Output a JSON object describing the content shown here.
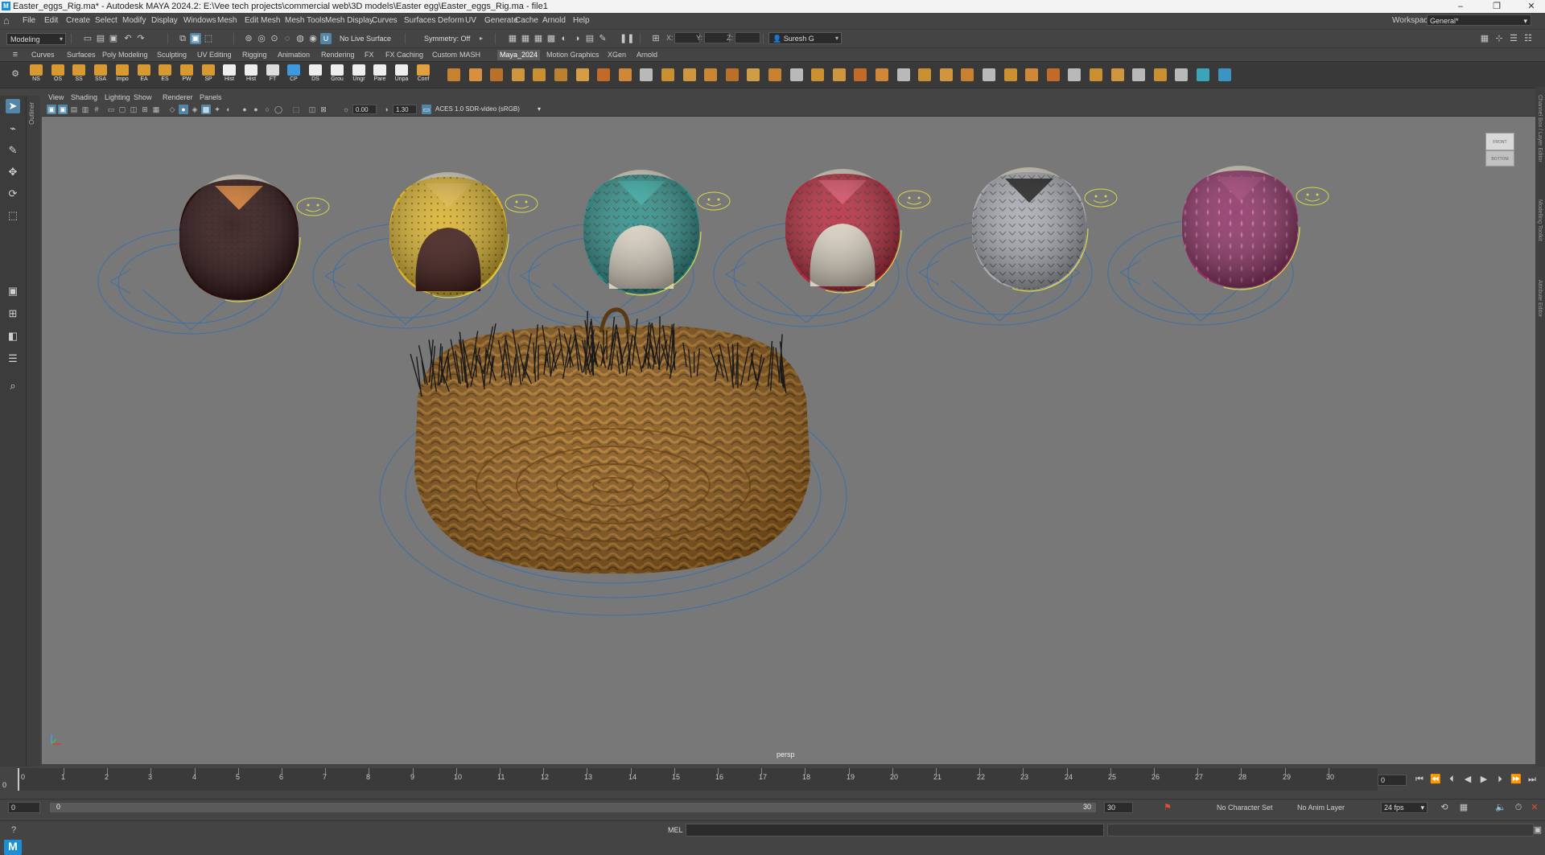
{
  "titlebar": {
    "title": "Easter_eggs_Rig.ma* - Autodesk MAYA 2024.2: E:\\Vee tech projects\\commercial web\\3D models\\Easter egg\\Easter_eggs_Rig.ma  -  file1",
    "logo": "M",
    "minimize": "–",
    "restore": "❐",
    "close": "✕"
  },
  "menu": [
    "File",
    "Edit",
    "Create",
    "Select",
    "Modify",
    "Display",
    "Windows",
    "Mesh",
    "Edit Mesh",
    "Mesh Tools",
    "Mesh Display",
    "Curves",
    "Surfaces",
    "Deform",
    "UV",
    "Generate",
    "Cache",
    "Arnold",
    "Help"
  ],
  "workspace": {
    "label": "Workspace:",
    "value": "General*"
  },
  "statusline": {
    "mode": "Modeling",
    "live_surface": "No Live Surface",
    "symmetry": "Symmetry: Off",
    "x_label": "X:",
    "y_label": "Y:",
    "z_label": "Z:",
    "user": "Suresh G"
  },
  "shelf_tabs": [
    "Curves",
    "Surfaces",
    "Poly Modeling",
    "Sculpting",
    "UV Editing",
    "Rigging",
    "Animation",
    "Rendering",
    "FX",
    "FX Caching",
    "Custom",
    "MASH",
    "Maya_2024",
    "Motion Graphics",
    "XGen",
    "Arnold"
  ],
  "shelf_active_tab": "Maya_2024",
  "shelf_buttons": [
    "NS",
    "OS",
    "SS",
    "SSA",
    "Impo",
    "EA",
    "ES",
    "PW",
    "SP",
    "Hist",
    "Hist",
    "FT",
    "CP",
    "DS",
    "Grou",
    "Ungr",
    "Pare",
    "Unpa",
    "Conf"
  ],
  "panel_menu": [
    "View",
    "Shading",
    "Lighting",
    "Show",
    "Renderer",
    "Panels"
  ],
  "panel_toolbar": {
    "exposure": "0.00",
    "gamma": "1.30",
    "color_space": "ACES 1.0 SDR-video (sRGB)"
  },
  "viewport": {
    "camera": "persp",
    "viewcube_top": "FRONT",
    "viewcube_bottom": "BOTTOM"
  },
  "outliner_label": "Outliner",
  "right_strip": [
    "Channel Box / Layer Editor",
    "Modelling Toolkit",
    "Attribute Editor"
  ],
  "timeslider": {
    "ticks": [
      "1",
      "2",
      "3",
      "4",
      "5",
      "6",
      "7",
      "8",
      "9",
      "10",
      "11",
      "12",
      "13",
      "14",
      "15",
      "16",
      "17",
      "18",
      "19",
      "20",
      "21",
      "22",
      "23",
      "24",
      "25",
      "26",
      "27",
      "28",
      "29",
      "30"
    ],
    "current_frame": "0",
    "frame_field": "0",
    "left_zero": "0"
  },
  "rangeslider": {
    "start": "0",
    "inner_start": "0",
    "inner_end": "30",
    "end": "30",
    "character_set": "No Character Set",
    "anim_layer": "No Anim Layer",
    "fps": "24 fps"
  },
  "cmdline": {
    "label": "MEL"
  },
  "maya_badge": "M",
  "colors": {
    "accent": "#5285a6",
    "viewport_bg": "#787878",
    "selection_yellow": "#d8d84a",
    "rig_blue": "#3d6fa8"
  },
  "eggs": [
    {
      "name": "egg-1-dark-suit",
      "pattern": "#2a0d0d",
      "cap": "#d07428"
    },
    {
      "name": "egg-2-yellow-dress",
      "pattern": "#d9b12a",
      "cap": "#e1b840"
    },
    {
      "name": "egg-3-teal-shirt",
      "pattern": "#2b8c86",
      "cap": "#30a8a0"
    },
    {
      "name": "egg-4-red-dress",
      "pattern": "#b5273a",
      "cap": "#d54860"
    },
    {
      "name": "egg-5-grey-suit",
      "pattern": "#a5a8ae",
      "cap": "#1a1a1a"
    },
    {
      "name": "egg-6-pink-dress",
      "pattern": "#8c2f62",
      "cap": "#a03a70"
    }
  ]
}
